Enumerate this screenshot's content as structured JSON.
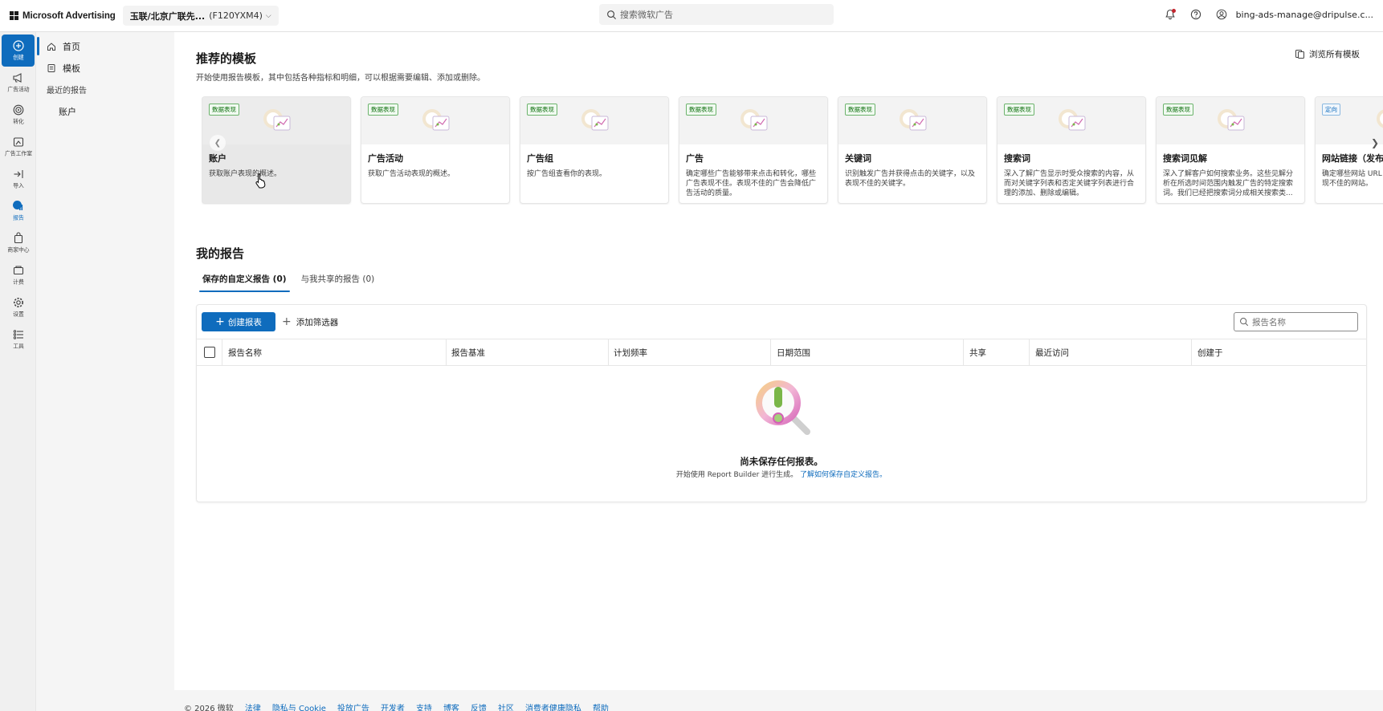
{
  "topbar": {
    "brand": "Microsoft Advertising",
    "account_name": "玉联/北京广联先...",
    "account_id": "(F120YXM4)",
    "search_placeholder": "搜索微软广告",
    "user_email": "bing-ads-manage@dripulse.c..."
  },
  "rail": {
    "items": [
      {
        "label": "创建",
        "icon": "plus-circle-icon"
      },
      {
        "label": "广告活动",
        "icon": "megaphone-icon"
      },
      {
        "label": "转化",
        "icon": "target-icon"
      },
      {
        "label": "广告工作室",
        "icon": "paint-icon"
      },
      {
        "label": "导入",
        "icon": "import-icon"
      },
      {
        "label": "报告",
        "icon": "report-icon"
      },
      {
        "label": "商家中心",
        "icon": "shopping-bag-icon"
      },
      {
        "label": "计费",
        "icon": "billing-icon"
      },
      {
        "label": "设置",
        "icon": "gear-icon"
      },
      {
        "label": "工具",
        "icon": "tools-icon"
      }
    ]
  },
  "subnav": {
    "home": "首页",
    "templates": "模板",
    "recent_section": "最近的报告",
    "recent_item": "账户"
  },
  "recommended": {
    "title": "推荐的模板",
    "description": "开始使用报告模板，其中包括各种指标和明细，可以根据需要编辑、添加或删除。",
    "browse_all": "浏览所有模板",
    "cards": [
      {
        "tag": "数据表现",
        "title": "账户",
        "desc": "获取账户表现的概述。"
      },
      {
        "tag": "数据表现",
        "title": "广告活动",
        "desc": "获取广告活动表现的概述。"
      },
      {
        "tag": "数据表现",
        "title": "广告组",
        "desc": "按广告组查看你的表现。"
      },
      {
        "tag": "数据表现",
        "title": "广告",
        "desc": "确定哪些广告能够带来点击和转化，哪些广告表现不佳。表现不佳的广告会降低广告活动的质量。"
      },
      {
        "tag": "数据表现",
        "title": "关键词",
        "desc": "识别触发广告并获得点击的关键字，以及表现不佳的关键字。"
      },
      {
        "tag": "数据表现",
        "title": "搜索词",
        "desc": "深入了解广告显示时受众搜索的内容，从而对关键字列表和否定关键字列表进行合理的添加、删除或编辑。"
      },
      {
        "tag": "数据表现",
        "title": "搜索词见解",
        "desc": "深入了解客户如何搜索业务。这些见解分析在所选时间范围内触发广告的特定搜索词。我们已经把搜索词分成相关搜索类..."
      },
      {
        "tag": "定向",
        "title": "网站链接（发布",
        "desc": "确定哪些网站 URL 目标设置表现良好，表现不佳的网站。"
      }
    ]
  },
  "my_reports": {
    "title": "我的报告",
    "tabs": [
      "保存的自定义报告 (0)",
      "与我共享的报告 (0)"
    ],
    "create_button": "创建报表",
    "add_filter": "添加筛选器",
    "search_placeholder": "报告名称",
    "columns": [
      "报告名称",
      "报告基准",
      "计划频率",
      "日期范围",
      "共享",
      "最近访问",
      "创建于"
    ],
    "empty_title": "尚未保存任何报表。",
    "empty_sub": "开始使用 Report Builder 进行生成。",
    "empty_link": "了解如何保存自定义报告。"
  },
  "footer": {
    "copyright": "© 2026 微软",
    "links": [
      "法律",
      "隐私与 Cookie",
      "投放广告",
      "开发者",
      "支持",
      "博客",
      "反馈",
      "社区",
      "消费者健康隐私",
      "帮助"
    ]
  },
  "colors": {
    "accent": "#0f6cbd",
    "tag_green": "#0e700e",
    "notification": "#c4262e"
  }
}
